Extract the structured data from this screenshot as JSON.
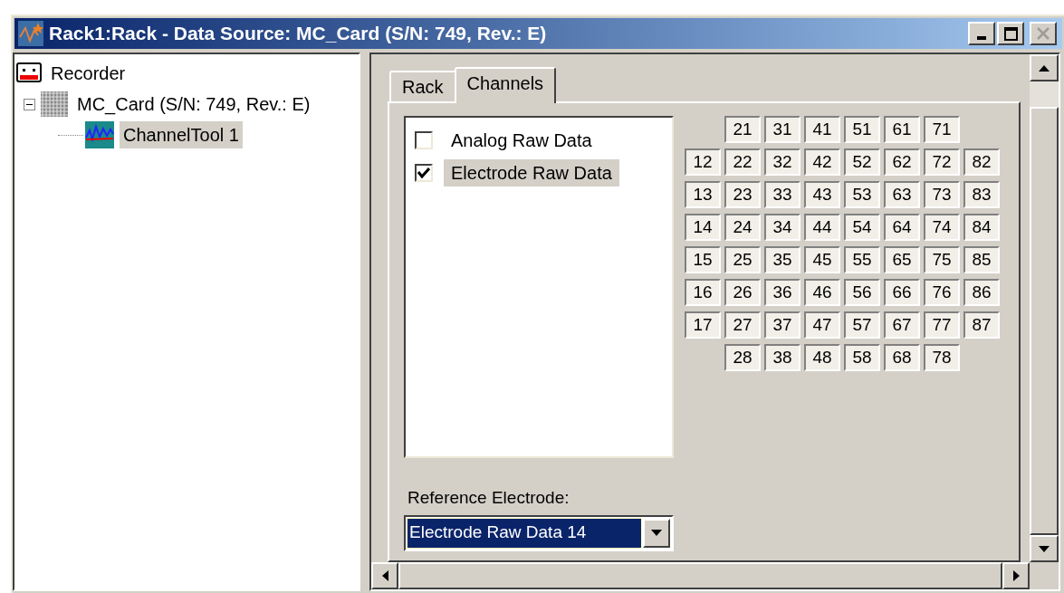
{
  "window": {
    "title": "Rack1:Rack - Data Source: MC_Card (S/N: 749, Rev.: E)",
    "buttons": [
      {
        "kind": "minimize",
        "disabled": false
      },
      {
        "kind": "maximize",
        "disabled": false
      },
      {
        "kind": "close",
        "disabled": true
      }
    ]
  },
  "tree": [
    {
      "label": "Recorder",
      "kind": "recorder",
      "selected": false,
      "children": [
        {
          "label": "MC_Card (S/N: 749, Rev.: E)",
          "kind": "card",
          "selected": false,
          "expanded": true,
          "children": [
            {
              "label": "ChannelTool 1",
              "kind": "tool",
              "selected": true
            }
          ]
        }
      ]
    }
  ],
  "tabs": [
    {
      "label": "Rack",
      "selected": false
    },
    {
      "label": "Channels",
      "selected": true
    }
  ],
  "streams": [
    {
      "label": "Analog Raw Data",
      "checked": false,
      "selected": false
    },
    {
      "label": "Electrode Raw Data",
      "checked": true,
      "selected": true
    }
  ],
  "electrodes": [
    [
      "21",
      "31",
      "41",
      "51",
      "61",
      "71"
    ],
    [
      "12",
      "22",
      "32",
      "42",
      "52",
      "62",
      "72",
      "82"
    ],
    [
      "13",
      "23",
      "33",
      "43",
      "53",
      "63",
      "73",
      "83"
    ],
    [
      "14",
      "24",
      "34",
      "44",
      "54",
      "64",
      "74",
      "84"
    ],
    [
      "15",
      "25",
      "35",
      "45",
      "55",
      "65",
      "75",
      "85"
    ],
    [
      "16",
      "26",
      "36",
      "46",
      "56",
      "66",
      "76",
      "86"
    ],
    [
      "17",
      "27",
      "37",
      "47",
      "57",
      "67",
      "77",
      "87"
    ],
    [
      "28",
      "38",
      "48",
      "58",
      "68",
      "78"
    ]
  ],
  "reference": {
    "label": "Reference Electrode:",
    "value": "Electrode Raw Data 14"
  }
}
